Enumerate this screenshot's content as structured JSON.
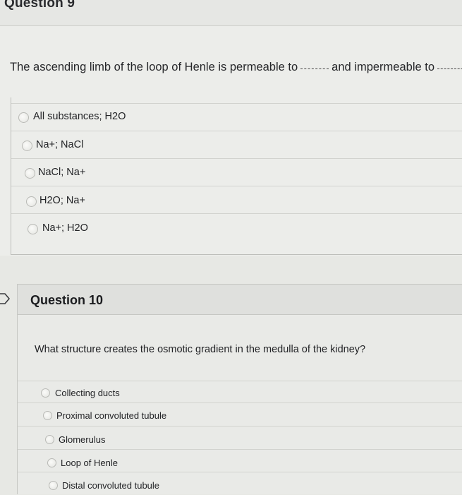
{
  "question9": {
    "title": "Question 9",
    "text_part1": "The ascending limb of the loop of Henle is permeable to",
    "text_part2": "and impermeable to",
    "options": [
      "All substances; H2O",
      "Na+; NaCl",
      "NaCl; Na+",
      "H2O; Na+",
      "Na+; H2O"
    ]
  },
  "question10": {
    "title": "Question 10",
    "text": "What structure creates the osmotic gradient in the medulla of the kidney?",
    "options": [
      "Collecting ducts",
      "Proximal convoluted tubule",
      "Glomerulus",
      "Loop of Henle",
      "Distal convoluted tubule"
    ]
  },
  "icons": {
    "current_question": "arrow-right-icon"
  },
  "colors": {
    "background": "#e7e8e4",
    "divider": "#d2d3cf",
    "text": "#1f2022"
  }
}
